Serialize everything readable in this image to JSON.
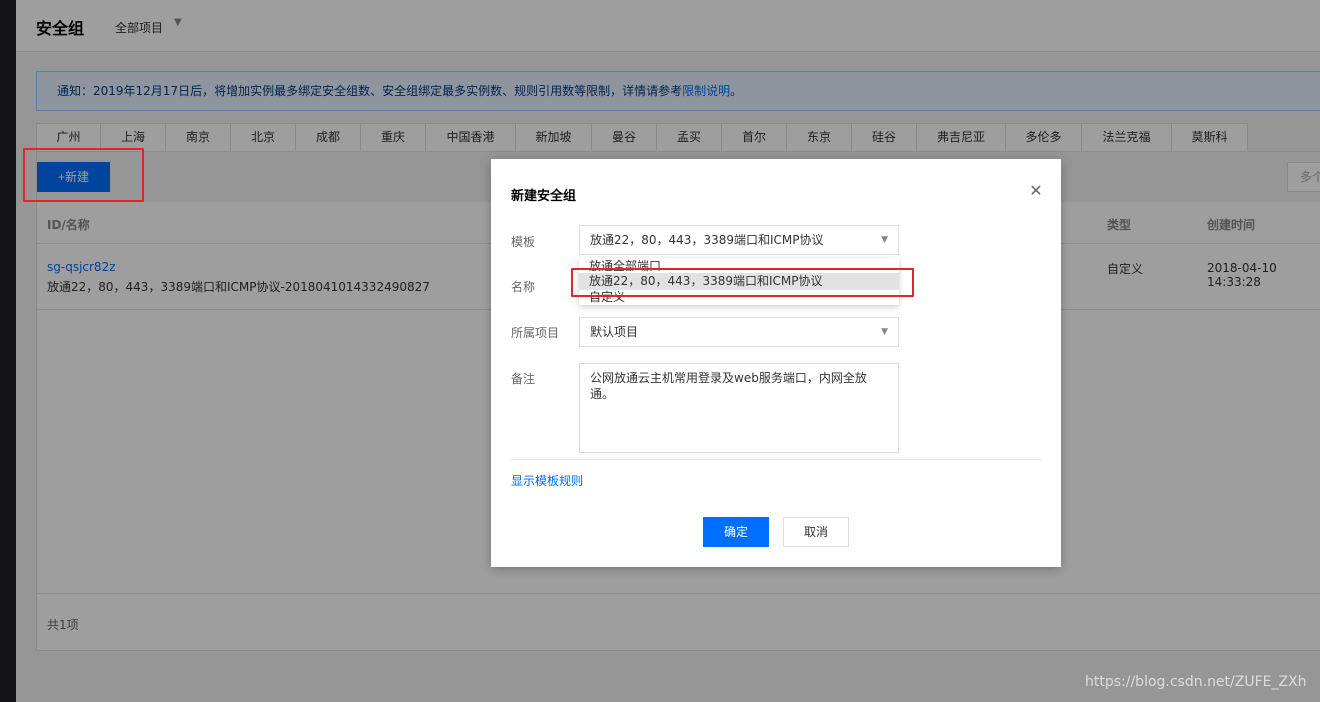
{
  "page": {
    "title": "安全组",
    "project_selector": "全部项目"
  },
  "notice": {
    "text": "通知：2019年12月17日后，将增加实例最多绑定安全组数、安全组绑定最多实例数、规则引用数等限制，详情请参考",
    "link": "限制说明",
    "suffix": "。"
  },
  "regions": [
    "广州",
    "上海",
    "南京",
    "北京",
    "成都",
    "重庆",
    "中国香港",
    "新加坡",
    "曼谷",
    "孟买",
    "首尔",
    "东京",
    "硅谷",
    "弗吉尼亚",
    "多伦多",
    "法兰克福",
    "莫斯科"
  ],
  "toolbar": {
    "new_label": "+新建",
    "multi_label": "多个"
  },
  "table": {
    "columns": {
      "id_name": "ID/名称",
      "type": "类型",
      "created": "创建时间"
    },
    "rows": [
      {
        "id": "sg-qsjcr82z",
        "name": "放通22，80，443，3389端口和ICMP协议-20180410143324908​27",
        "type": "自定义",
        "created": "2018-04-10 14:33:28"
      }
    ],
    "total": "共1项"
  },
  "dialog": {
    "title": "新建安全组",
    "template_label": "模板",
    "template_value": "放通22，80，443，3389端口和ICMP协议",
    "template_options": [
      "放通全部端口",
      "放通22，80，443，3389端口和ICMP协议",
      "自定义"
    ],
    "name_label": "名称",
    "project_label": "所属项目",
    "project_value": "默认项目",
    "remark_label": "备注",
    "remark_value": "公网放通云主机常用登录及web服务端口，内网全放通。",
    "rules_link": "显示模板规则",
    "ok_label": "确定",
    "cancel_label": "取消"
  },
  "watermark": "https://blog.csdn.net/ZUFE_ZXh",
  "colors": {
    "accent": "#006eff",
    "highlight_box": "#e0262a",
    "notice_bg": "#e5f0ff"
  }
}
